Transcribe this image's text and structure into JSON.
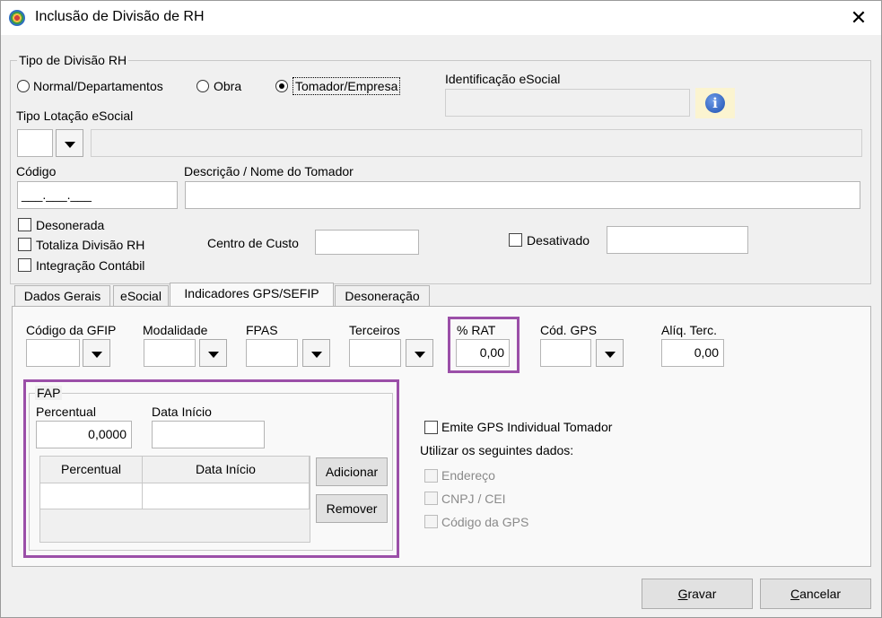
{
  "window": {
    "title": "Inclusão de Divisão de RH",
    "close_glyph": "✕"
  },
  "tipo_divisao": {
    "group_title": "Tipo de Divisão RH",
    "options": [
      {
        "label": "Normal/Departamentos",
        "checked": false
      },
      {
        "label": "Obra",
        "checked": false
      },
      {
        "label": "Tomador/Empresa",
        "checked": true
      }
    ],
    "identificacao_label": "Identificação eSocial",
    "identificacao_value": "",
    "info_icon": "i",
    "tipo_lotacao_label": "Tipo Lotação eSocial",
    "codigo_label": "Código",
    "codigo_mask": "___.___.___",
    "descricao_label": "Descrição / Nome do Tomador",
    "descricao_value": "",
    "checks": [
      {
        "label": "Desonerada",
        "checked": false
      },
      {
        "label": "Totaliza Divisão RH",
        "checked": false
      },
      {
        "label": "Integração Contábil",
        "checked": false
      }
    ],
    "centro_custo_label": "Centro de Custo",
    "desativado_label": "Desativado"
  },
  "tabs": [
    {
      "label": "Dados Gerais",
      "active": false
    },
    {
      "label": "eSocial",
      "active": false
    },
    {
      "label": "Indicadores GPS/SEFIP",
      "active": true
    },
    {
      "label": "Desoneração",
      "active": false
    }
  ],
  "gps": {
    "codigo_gfip_label": "Código da GFIP",
    "modalidade_label": "Modalidade",
    "fpas_label": "FPAS",
    "terceiros_label": "Terceiros",
    "rat_label": "% RAT",
    "rat_value": "0,00",
    "cod_gps_label": "Cód. GPS",
    "aliq_terc_label": "Alíq. Terc.",
    "aliq_terc_value": "0,00"
  },
  "fap": {
    "group_title": "FAP",
    "percentual_label": "Percentual",
    "percentual_value": "0,0000",
    "data_inicio_label": "Data Início",
    "table_headers": [
      "Percentual",
      "Data Início"
    ],
    "adicionar_label": "Adicionar",
    "remover_label": "Remover"
  },
  "emite": {
    "label": "Emite GPS Individual Tomador",
    "utilizar_label": "Utilizar os seguintes dados:",
    "items": [
      "Endereço",
      "CNPJ / CEI",
      "Código da GPS"
    ]
  },
  "footer": {
    "gravar_first": "G",
    "gravar_rest": "ravar",
    "cancelar_first": "C",
    "cancelar_rest": "ancelar"
  },
  "colors": {
    "highlight": "#9b4fa8",
    "info_bg": "#fbf4d0",
    "info_icon": "#1b4fb0"
  }
}
